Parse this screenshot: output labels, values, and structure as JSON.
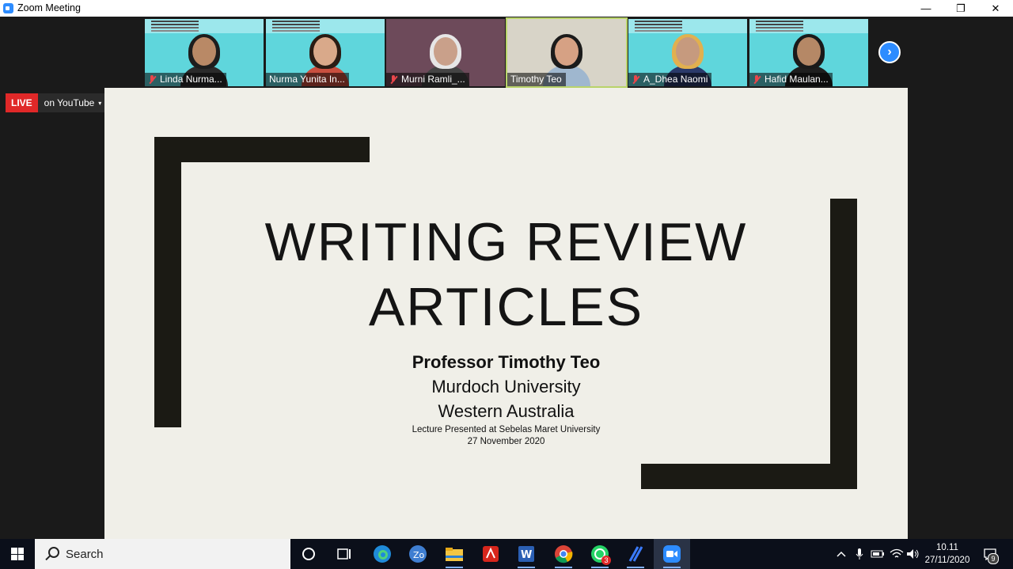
{
  "window": {
    "title": "Zoom Meeting",
    "minimize": "—",
    "restore": "❐",
    "close": "✕"
  },
  "gallery": {
    "participants": [
      {
        "name": "Linda Nurma...",
        "muted": true,
        "bg": "#5fd6dc",
        "hair": "#1d1d1d",
        "skin": "#b98966",
        "shirt": "#2a2a2a"
      },
      {
        "name": "Nurma Yunita In...",
        "muted": false,
        "bg": "#5fd6dc",
        "hair": "#2a1c14",
        "skin": "#d9a98a",
        "shirt": "#c94f3f"
      },
      {
        "name": "Murni Ramli_...",
        "muted": true,
        "bg": "#6d4a5a",
        "hair": "#e6e6e6",
        "skin": "#c9a08a",
        "shirt": "#444444"
      },
      {
        "name": "Timothy Teo",
        "muted": false,
        "bg": "#d8d4c8",
        "hair": "#1b1b1b",
        "skin": "#d6a184",
        "shirt": "#9fb7cf"
      },
      {
        "name": "A_Dhea Naomi",
        "muted": true,
        "bg": "#5fd6dc",
        "hair": "#e1b04f",
        "skin": "#c69a7e",
        "shirt": "#2a3a6a"
      },
      {
        "name": "Hafid Maulan...",
        "muted": true,
        "bg": "#5fd6dc",
        "hair": "#1a1a1a",
        "skin": "#b58866",
        "shirt": "#1e1e1e"
      }
    ],
    "next_icon": "›"
  },
  "live": {
    "badge": "LIVE",
    "platform": "on YouTube",
    "caret": "▾"
  },
  "slide": {
    "title_line1": "WRITING REVIEW",
    "title_line2": "ARTICLES",
    "presenter": "Professor Timothy Teo",
    "affiliation1": "Murdoch University",
    "affiliation2": "Western Australia",
    "note": "Lecture Presented at Sebelas Maret University",
    "date": "27 November 2020"
  },
  "taskbar": {
    "search_label": "Search",
    "apps": [
      "cortana-icon",
      "task-view-icon",
      "edge-icon",
      "photos-icon",
      "file-explorer-icon",
      "acrobat-icon",
      "word-icon",
      "chrome-icon",
      "whatsapp-icon",
      "tool-icon",
      "zoom-icon"
    ],
    "whatsapp_badge": "3",
    "notification_badge": "9",
    "time": "10.11",
    "date": "27/11/2020"
  }
}
